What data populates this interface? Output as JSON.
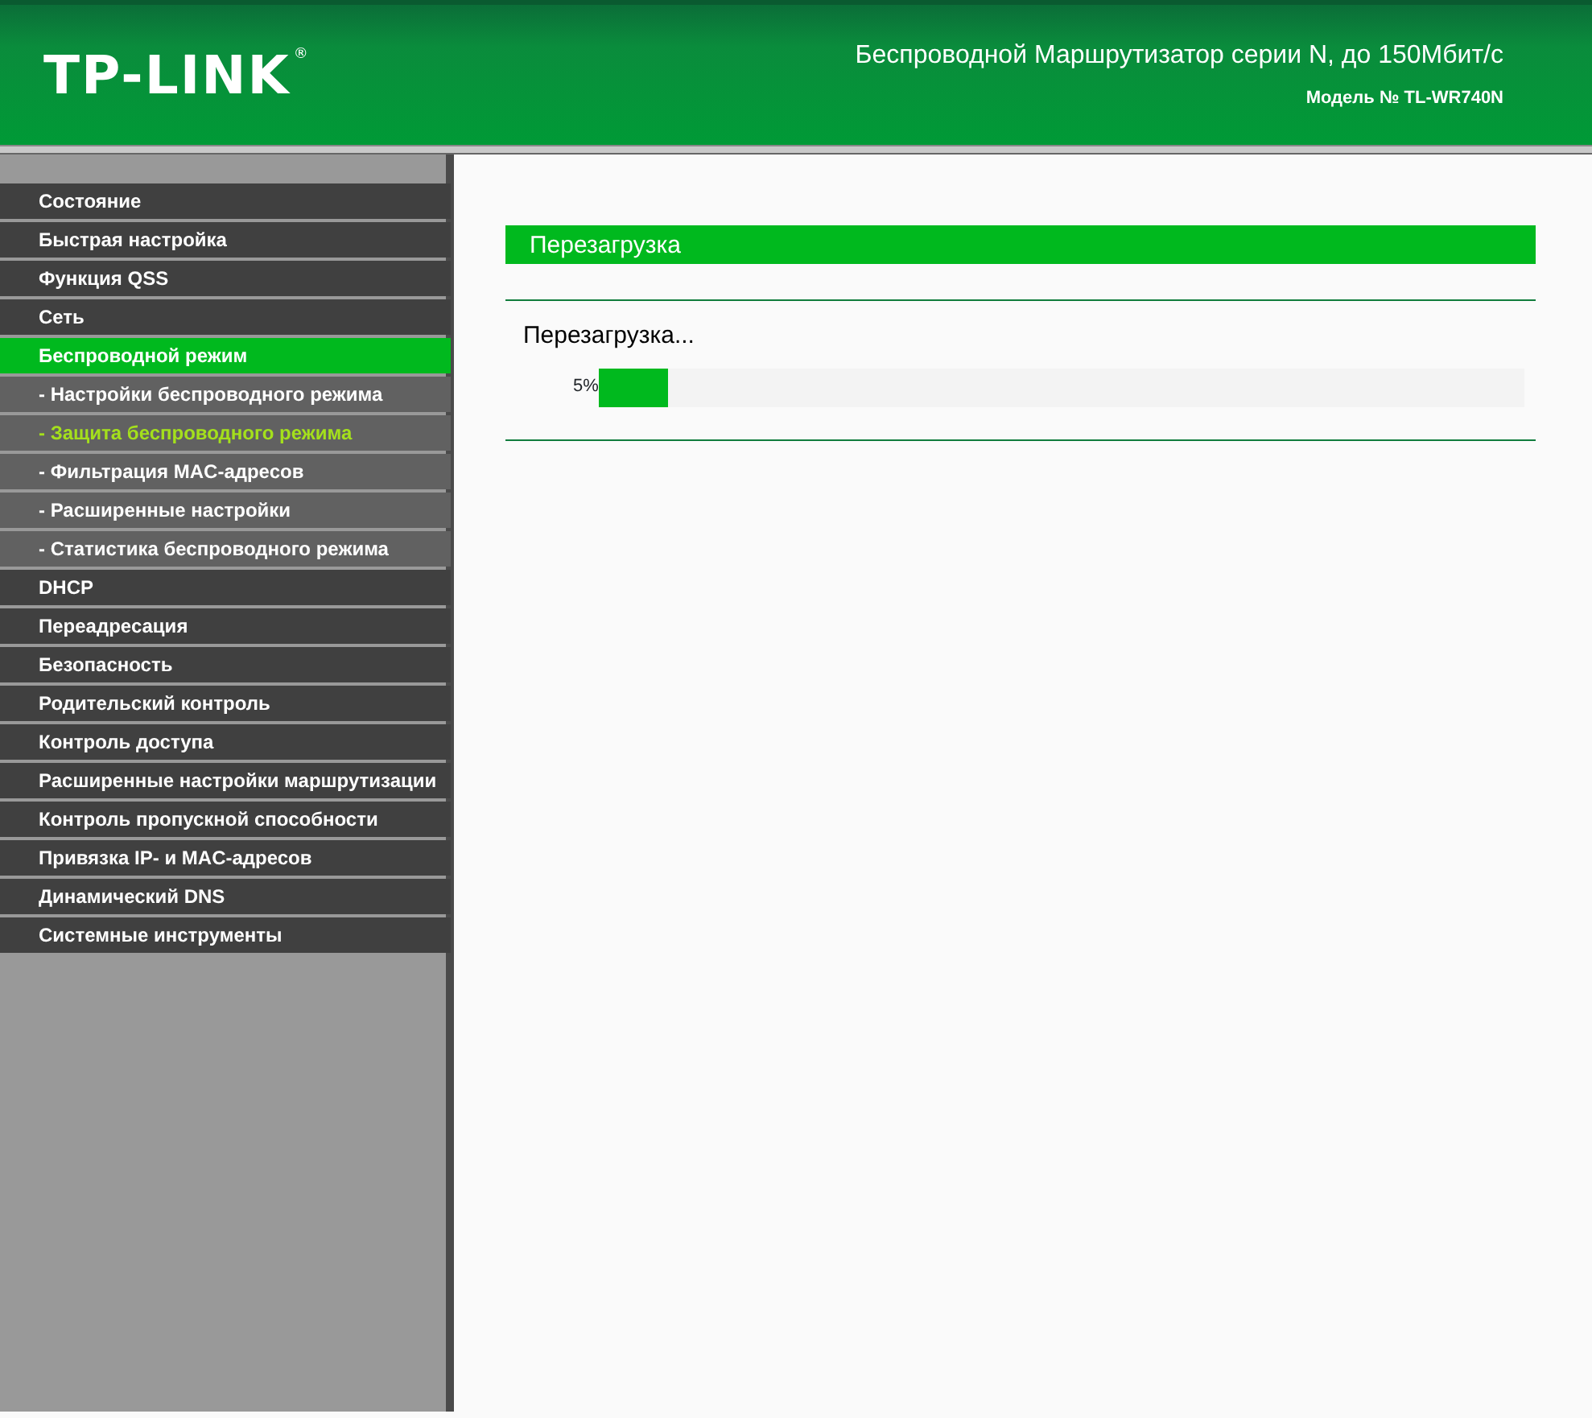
{
  "header": {
    "logo": "TP-LINK",
    "registered_mark": "®",
    "product": "Беспроводной Маршрутизатор серии N, до 150Мбит/с",
    "model": "Модель № TL-WR740N"
  },
  "menu": [
    {
      "label": "Состояние",
      "kind": "main",
      "selected": false
    },
    {
      "label": "Быстрая настройка",
      "kind": "main",
      "selected": false
    },
    {
      "label": "Функция QSS",
      "kind": "main",
      "selected": false
    },
    {
      "label": "Сеть",
      "kind": "main",
      "selected": false
    },
    {
      "label": "Беспроводной режим",
      "kind": "main",
      "selected": true
    },
    {
      "label": "- Настройки беспроводного режима",
      "kind": "sub",
      "selected": false
    },
    {
      "label": "- Защита беспроводного режима",
      "kind": "sub",
      "selected": true
    },
    {
      "label": "- Фильтрация MAC-адресов",
      "kind": "sub",
      "selected": false
    },
    {
      "label": "- Расширенные настройки",
      "kind": "sub",
      "selected": false
    },
    {
      "label": "- Статистика беспроводного режима",
      "kind": "sub",
      "selected": false
    },
    {
      "label": "DHCP",
      "kind": "main",
      "selected": false
    },
    {
      "label": "Переадресация",
      "kind": "main",
      "selected": false
    },
    {
      "label": "Безопасность",
      "kind": "main",
      "selected": false
    },
    {
      "label": "Родительский контроль",
      "kind": "main",
      "selected": false
    },
    {
      "label": "Контроль доступа",
      "kind": "main",
      "selected": false
    },
    {
      "label": "Расширенные настройки маршрутизации",
      "kind": "main",
      "selected": false
    },
    {
      "label": "Контроль пропускной способности",
      "kind": "main",
      "selected": false
    },
    {
      "label": "Привязка IP- и MAC-адресов",
      "kind": "main",
      "selected": false
    },
    {
      "label": "Динамический DNS",
      "kind": "main",
      "selected": false
    },
    {
      "label": "Системные инструменты",
      "kind": "main",
      "selected": false
    }
  ],
  "content": {
    "title": "Перезагрузка",
    "status": "Перезагрузка...",
    "progress": {
      "reading": "5%",
      "level": 0.075
    }
  }
}
